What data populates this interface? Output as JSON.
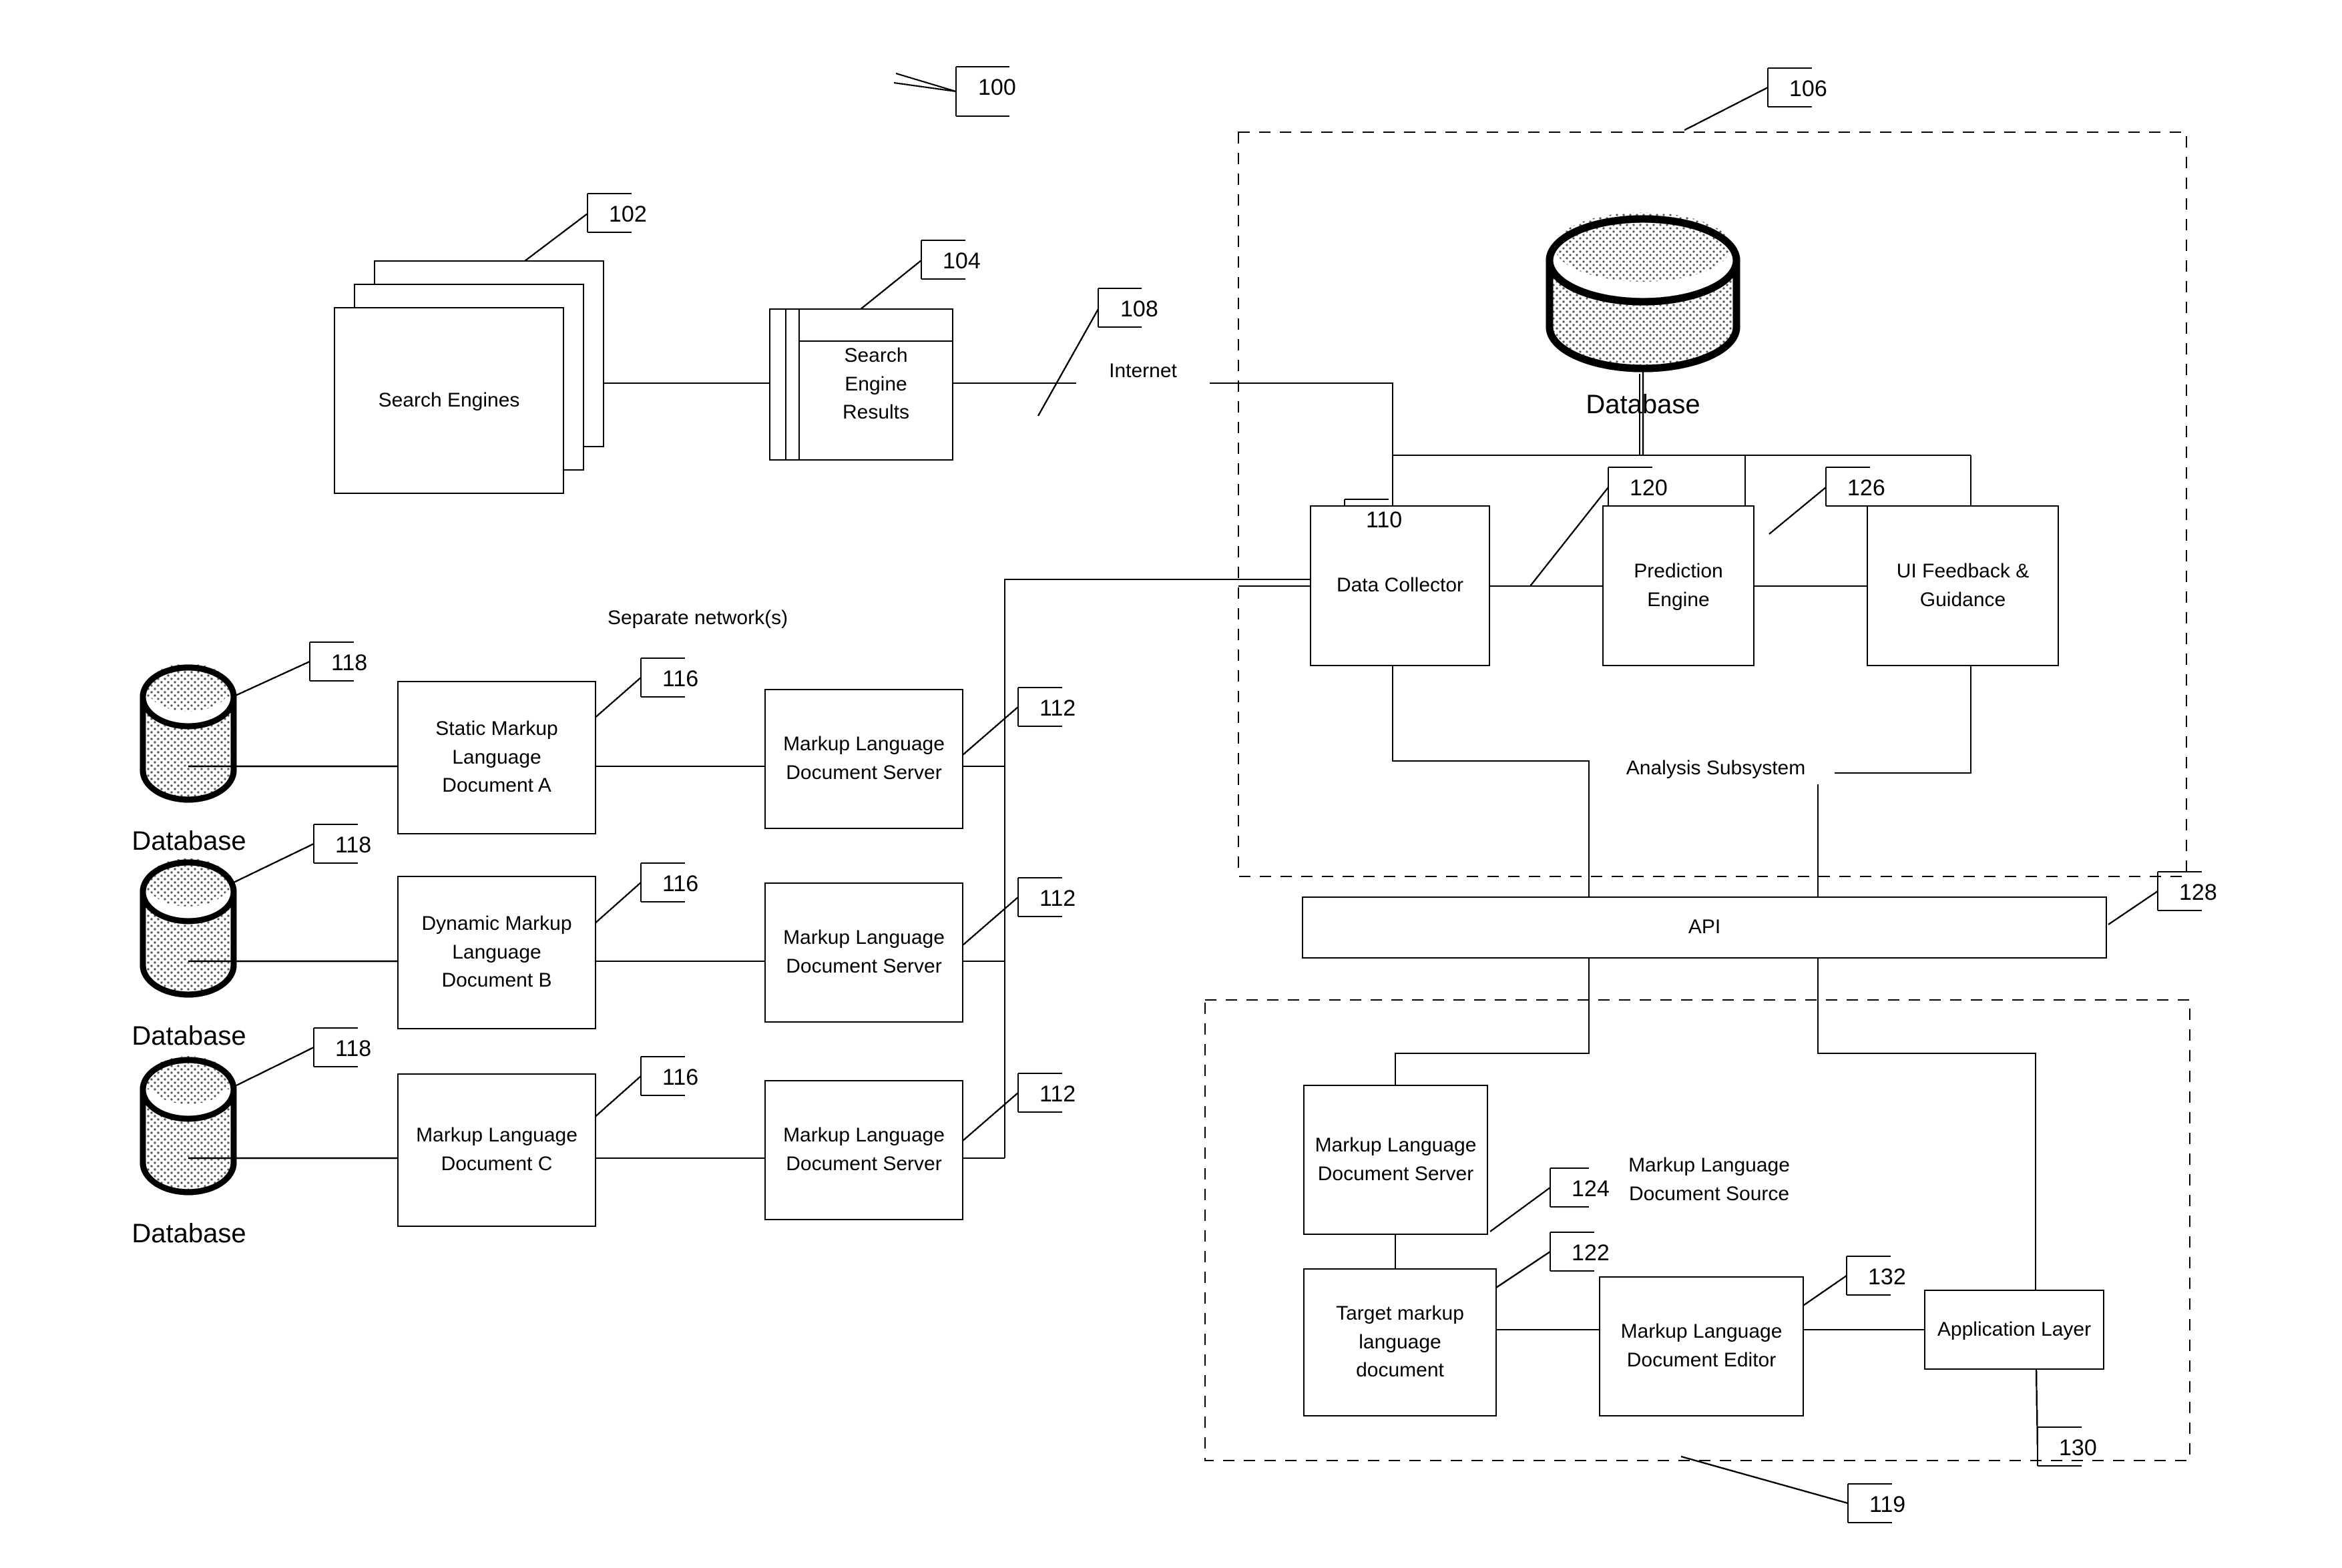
{
  "figure": {
    "system_ref": "100",
    "background": "#ffffff",
    "line_color": "#000000"
  },
  "nodes": {
    "search_engines": {
      "label": "Search Engines",
      "ref": "102"
    },
    "search_engine_results": {
      "label": "Search\nEngine\nResults",
      "ref": "104"
    },
    "internet": {
      "label": "Internet",
      "ref": "108"
    },
    "analysis_subsystem": {
      "label": "Analysis Subsystem",
      "ref": "106"
    },
    "top_database": {
      "label": "Database"
    },
    "data_collector": {
      "label": "Data Collector",
      "ref": "110"
    },
    "prediction_engine": {
      "label": "Prediction Engine",
      "ref": "120"
    },
    "ui_feedback": {
      "label": "UI Feedback &\nGuidance",
      "ref": "126"
    },
    "api": {
      "label": "API",
      "ref": "128"
    },
    "separate_networks": {
      "label": "Separate network(s)"
    },
    "doc_a": {
      "label": "Static Markup\nLanguage\nDocument A",
      "ref": "116"
    },
    "doc_b": {
      "label": "Dynamic Markup\nLanguage\nDocument B",
      "ref": "116"
    },
    "doc_c": {
      "label": "Markup Language\nDocument C",
      "ref": "116"
    },
    "server_a": {
      "label": "Markup Language\nDocument Server",
      "ref": "112"
    },
    "server_b": {
      "label": "Markup Language\nDocument Server",
      "ref": "112"
    },
    "server_c": {
      "label": "Markup Language\nDocument Server",
      "ref": "112"
    },
    "db_a": {
      "label": "Database",
      "ref": "118"
    },
    "db_b": {
      "label": "Database",
      "ref": "118"
    },
    "db_c": {
      "label": "Database",
      "ref": "118"
    },
    "mld_source": {
      "label": "Markup Language\nDocument Source",
      "ref": "119"
    },
    "mld_server_bottom": {
      "label": "Markup Language\nDocument Server",
      "ref": "124"
    },
    "target_doc": {
      "label": "Target markup\nlanguage\ndocument",
      "ref": "122"
    },
    "mld_editor": {
      "label": "Markup Language\nDocument Editor",
      "ref": "132"
    },
    "application_layer": {
      "label": "Application Layer",
      "ref": "130"
    }
  },
  "reference_numerals": [
    "100",
    "102",
    "104",
    "106",
    "108",
    "110",
    "112",
    "112",
    "112",
    "116",
    "116",
    "116",
    "118",
    "118",
    "118",
    "119",
    "120",
    "122",
    "124",
    "126",
    "128",
    "130",
    "132"
  ]
}
